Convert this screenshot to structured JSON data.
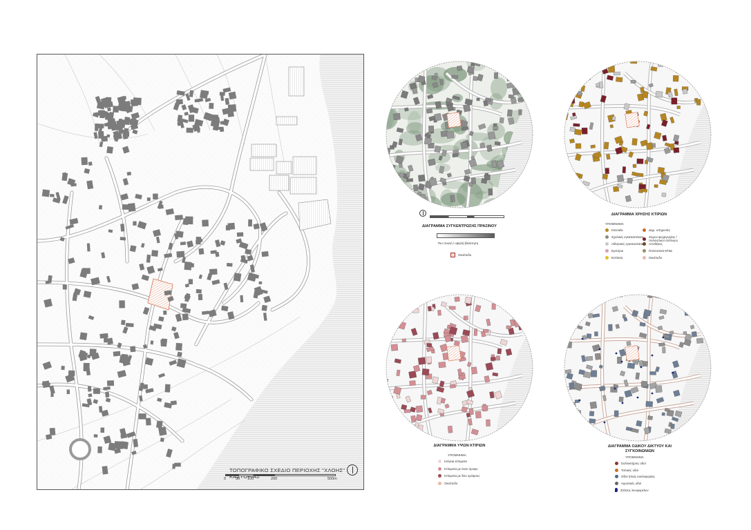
{
  "main_map": {
    "title": "ΤΟΠΟΓΡΑΦΙΚΟ ΣΧΕΔΙΟ ΠΕΡΙΟΧΗΣ \"ΧΛΟΗΣ\" ΚΑΣΤΟΡΙΑΣ",
    "scale_labels": [
      "0",
      "50",
      "100",
      "200",
      "500m"
    ]
  },
  "green_diagram": {
    "title": "ΔΙΑΓΡΑΜΜΑ ΣΥΓΚΕΝΤΡΩΣΗΣ ΠΡΑΣΙΝΟΥ",
    "gradient_caption": "Πιο πυκνή / υψηλή βλάστηση",
    "plot_label": "Οικόπεδο"
  },
  "land_use_diagram": {
    "title": "ΔΙΑΓΡΑΜΜΑ ΧΡΗΣΗΣ ΚΤΙΡΙΩΝ",
    "legend_heading": "ΥΠΟΜΝΗΜΑ",
    "legend_left": [
      {
        "label": "Κατοικία",
        "color": "#b8861e"
      },
      {
        "label": "Σχολικές εγκαταστάσεις",
        "color": "#8a8a7a"
      },
      {
        "label": "Αθλητικές εγκαταστάσεις",
        "color": "#c9c9c9"
      },
      {
        "label": "Εμπόριο",
        "color": "#d8a0b0"
      },
      {
        "label": "Εστίαση",
        "color": "#e2c21c"
      }
    ],
    "legend_right": [
      {
        "label": "Δημ. υπηρεσίες",
        "color": "#c86a2a"
      },
      {
        "label": "Χώροι ψυχαγωγίας / πολιτιστικοί σύλλογοι",
        "color": "#7a1f2a"
      },
      {
        "label": "Αποθήκες",
        "color": "#6b4a1f"
      },
      {
        "label": "Πολιτιστικά ΝΠΙΔ",
        "color": "#9c8a6a"
      },
      {
        "label": "Οικόπεδο",
        "color": "#e9b9a8"
      }
    ]
  },
  "height_diagram": {
    "title": "ΔΙΑΓΡΑΜΜΑ ΥΨΩΝ ΚΤΙΡΙΩΝ",
    "legend_heading": "ΥΠΟΜΝΗΜΑ",
    "legend": [
      {
        "label": "Ισόγεια κτίσματα",
        "color": "#f0d6d6"
      },
      {
        "label": "Κτίσματα με έναν όροφο",
        "color": "#d48f95"
      },
      {
        "label": "Κτίσματα με δύο ορόφους",
        "color": "#9b4a56"
      },
      {
        "label": "Οικόπεδο",
        "color": "#e9b9a8"
      }
    ]
  },
  "road_diagram": {
    "title": "ΔΙΑΓΡΑΜΜΑ ΟΔΙΚΟΥ ΔΙΚΤΥΟΥ ΚΑΙ ΣΥΓΚΟΙΝΩΝΙΩΝ",
    "legend_heading": "ΥΠΟΜΝΗΜΑ",
    "legend": [
      {
        "label": "Συλλεκτήριες οδοί",
        "color": "#8b3a2a"
      },
      {
        "label": "Τοπικές οδοί",
        "color": "#c8702a"
      },
      {
        "label": "Οδοί ήπιας κυκλοφορίας",
        "color": "#4a6a8a"
      },
      {
        "label": "Αγροτικές οδοί",
        "color": "#666666"
      },
      {
        "label": "Στάσεις λεωφορείων",
        "color": "#1a2a7a"
      }
    ]
  }
}
